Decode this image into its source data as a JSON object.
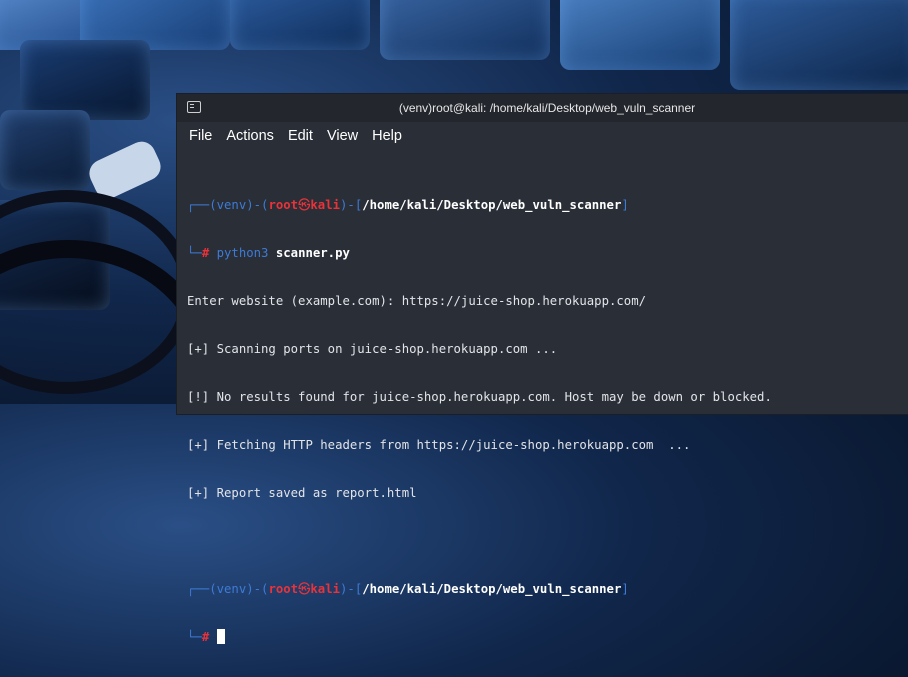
{
  "window": {
    "title": "(venv)root@kali: /home/kali/Desktop/web_vuln_scanner"
  },
  "menu": {
    "items": [
      "File",
      "Actions",
      "Edit",
      "View",
      "Help"
    ]
  },
  "prompt": {
    "venv": "(venv)",
    "user": "root",
    "symbol": "㉿",
    "host": "kali",
    "path": "/home/kali/Desktop/web_vuln_scanner",
    "hash": "#"
  },
  "session": {
    "command": "python3",
    "argument": "scanner.py",
    "output": [
      "Enter website (example.com): https://juice-shop.herokuapp.com/",
      "[+] Scanning ports on juice-shop.herokuapp.com ...",
      "[!] No results found for juice-shop.herokuapp.com. Host may be down or blocked.",
      "[+] Fetching HTTP headers from https://juice-shop.herokuapp.com  ...",
      "[+] Report saved as report.html"
    ]
  }
}
